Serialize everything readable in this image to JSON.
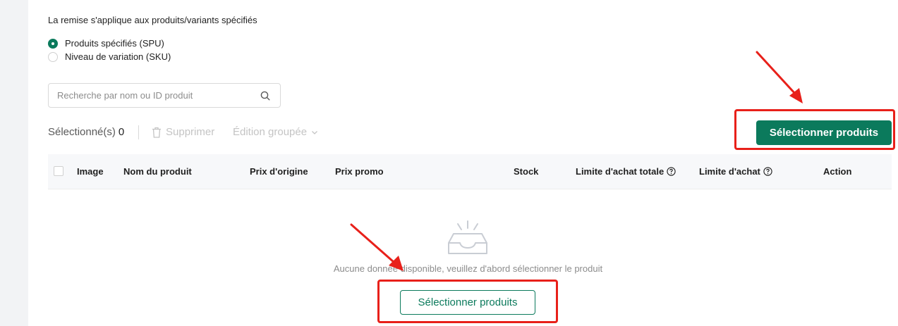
{
  "discount_scope": {
    "label": "La remise s'applique aux produits/variants spécifiés",
    "options": [
      {
        "label": "Produits spécifiés (SPU)",
        "checked": true
      },
      {
        "label": "Niveau de variation (SKU)",
        "checked": false
      }
    ]
  },
  "search": {
    "placeholder": "Recherche par nom ou ID produit",
    "value": "",
    "icon": "search-icon"
  },
  "toolbar": {
    "selected_label": "Sélectionné(s)",
    "selected_count": "0",
    "delete_label": "Supprimer",
    "bulk_edit_label": "Édition groupée",
    "select_products_label": "Sélectionner produits"
  },
  "table": {
    "columns": [
      "Image",
      "Nom du produit",
      "Prix d'origine",
      "Prix promo",
      "Stock",
      "Limite d'achat totale",
      "Limite d'achat",
      "Action"
    ]
  },
  "empty_state": {
    "text": "Aucune donnée disponible, veuillez d'abord sélectionner le produit",
    "button_label": "Sélectionner produits",
    "icon": "empty-inbox-icon"
  },
  "colors": {
    "primary": "#0b7a5c",
    "annotation": "#e8201a"
  }
}
